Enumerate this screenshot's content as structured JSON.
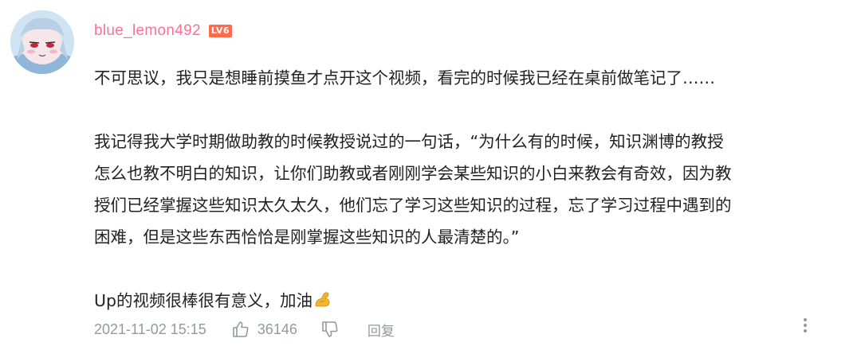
{
  "comment": {
    "user": {
      "name": "blue_lemon492",
      "level": "LV6"
    },
    "paragraphs": [
      "不可思议，我只是想睡前摸鱼才点开这个视频，看完的时候我已经在桌前做笔记了……",
      "我记得我大学时期做助教的时候教授说过的一句话，“为什么有的时候，知识渊博的教授\n怎么也教不明白的知识，让你们助教或者刚刚学会某些知识的小白来教会有奇效，因为教\n授们已经掌握这些知识太久太久，他们忘了学习这些知识的过程，忘了学习过程中遇到的\n困难，但是这些东西恰恰是刚掌握这些知识的人最清楚的。”",
      "Up的视频很棒很有意义，加油"
    ],
    "emoji": "flexed-biceps",
    "footer": {
      "timestamp": "2021-11-02 15:15",
      "like_count": "36146",
      "reply_label": "回复"
    },
    "colors": {
      "username": "#fb7299",
      "level_badge": "#ff6b4a",
      "text": "#222222",
      "meta": "#9499a0"
    }
  }
}
